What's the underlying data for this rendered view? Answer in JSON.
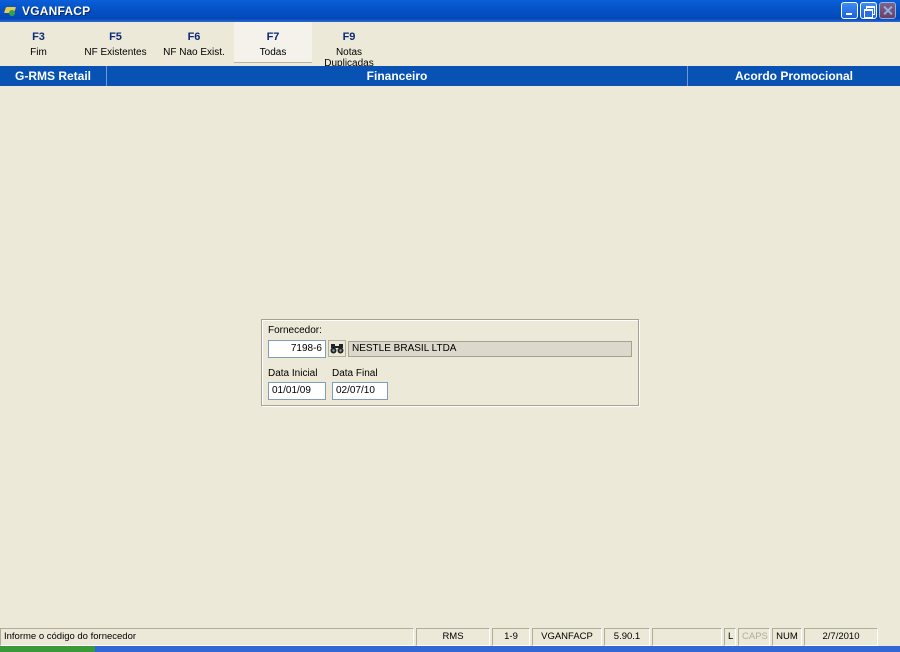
{
  "window": {
    "title": "VGANFACP"
  },
  "fkeys": [
    {
      "key": "F3",
      "label": "Fim"
    },
    {
      "key": "F5",
      "label": "NF Existentes"
    },
    {
      "key": "F6",
      "label": "NF Nao Exist."
    },
    {
      "key": "F7",
      "label": "Todas"
    },
    {
      "key": "F9",
      "label": "Notas Duplicadas"
    }
  ],
  "header": {
    "left": "G-RMS Retail",
    "center": "Financeiro",
    "right": "Acordo Promocional"
  },
  "form": {
    "fornecedor_label": "Fornecedor:",
    "fornecedor_code": "7198-6",
    "fornecedor_name": "NESTLE BRASIL LTDA",
    "data_inicial_label": "Data Inicial",
    "data_inicial": "01/01/09",
    "data_final_label": "Data Final",
    "data_final": "02/07/10",
    "lookup_icon": "binoculars-icon"
  },
  "statusbar": {
    "message": "Informe o código do fornecedor",
    "system": "RMS",
    "range": "1-9",
    "program": "VGANFACP",
    "version": "5.90.1",
    "empty": "",
    "l": "L",
    "caps": "CAPS",
    "num": "NUM",
    "date": "2/7/2010"
  },
  "colors": {
    "titlebar": "#0453c7",
    "band": "#0852b4",
    "background": "#ece9d8"
  }
}
